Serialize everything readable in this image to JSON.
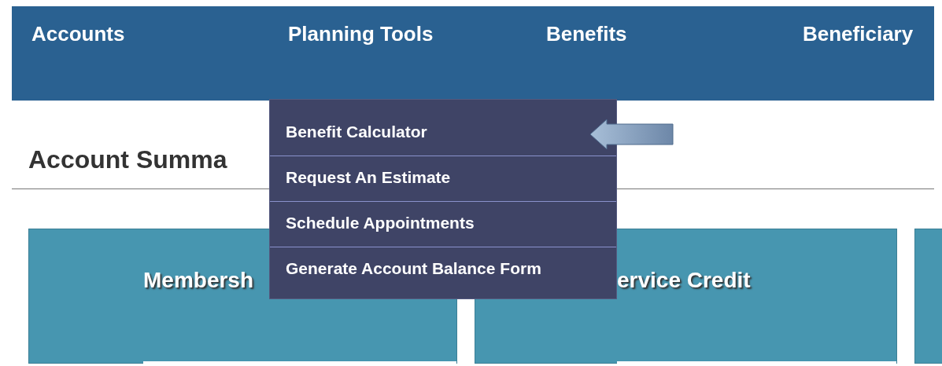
{
  "nav": [
    {
      "label": "Accounts"
    },
    {
      "label": "Planning Tools"
    },
    {
      "label": "Benefits"
    },
    {
      "label": "Beneficiary"
    }
  ],
  "heading": "Account Summa",
  "cards": [
    {
      "title": "Membersh"
    },
    {
      "title": "ervice Credit"
    }
  ],
  "dropdown": [
    {
      "label": "Benefit Calculator"
    },
    {
      "label": "Request An Estimate"
    },
    {
      "label": "Schedule Appointments"
    },
    {
      "label": "Generate Account Balance Form"
    }
  ]
}
